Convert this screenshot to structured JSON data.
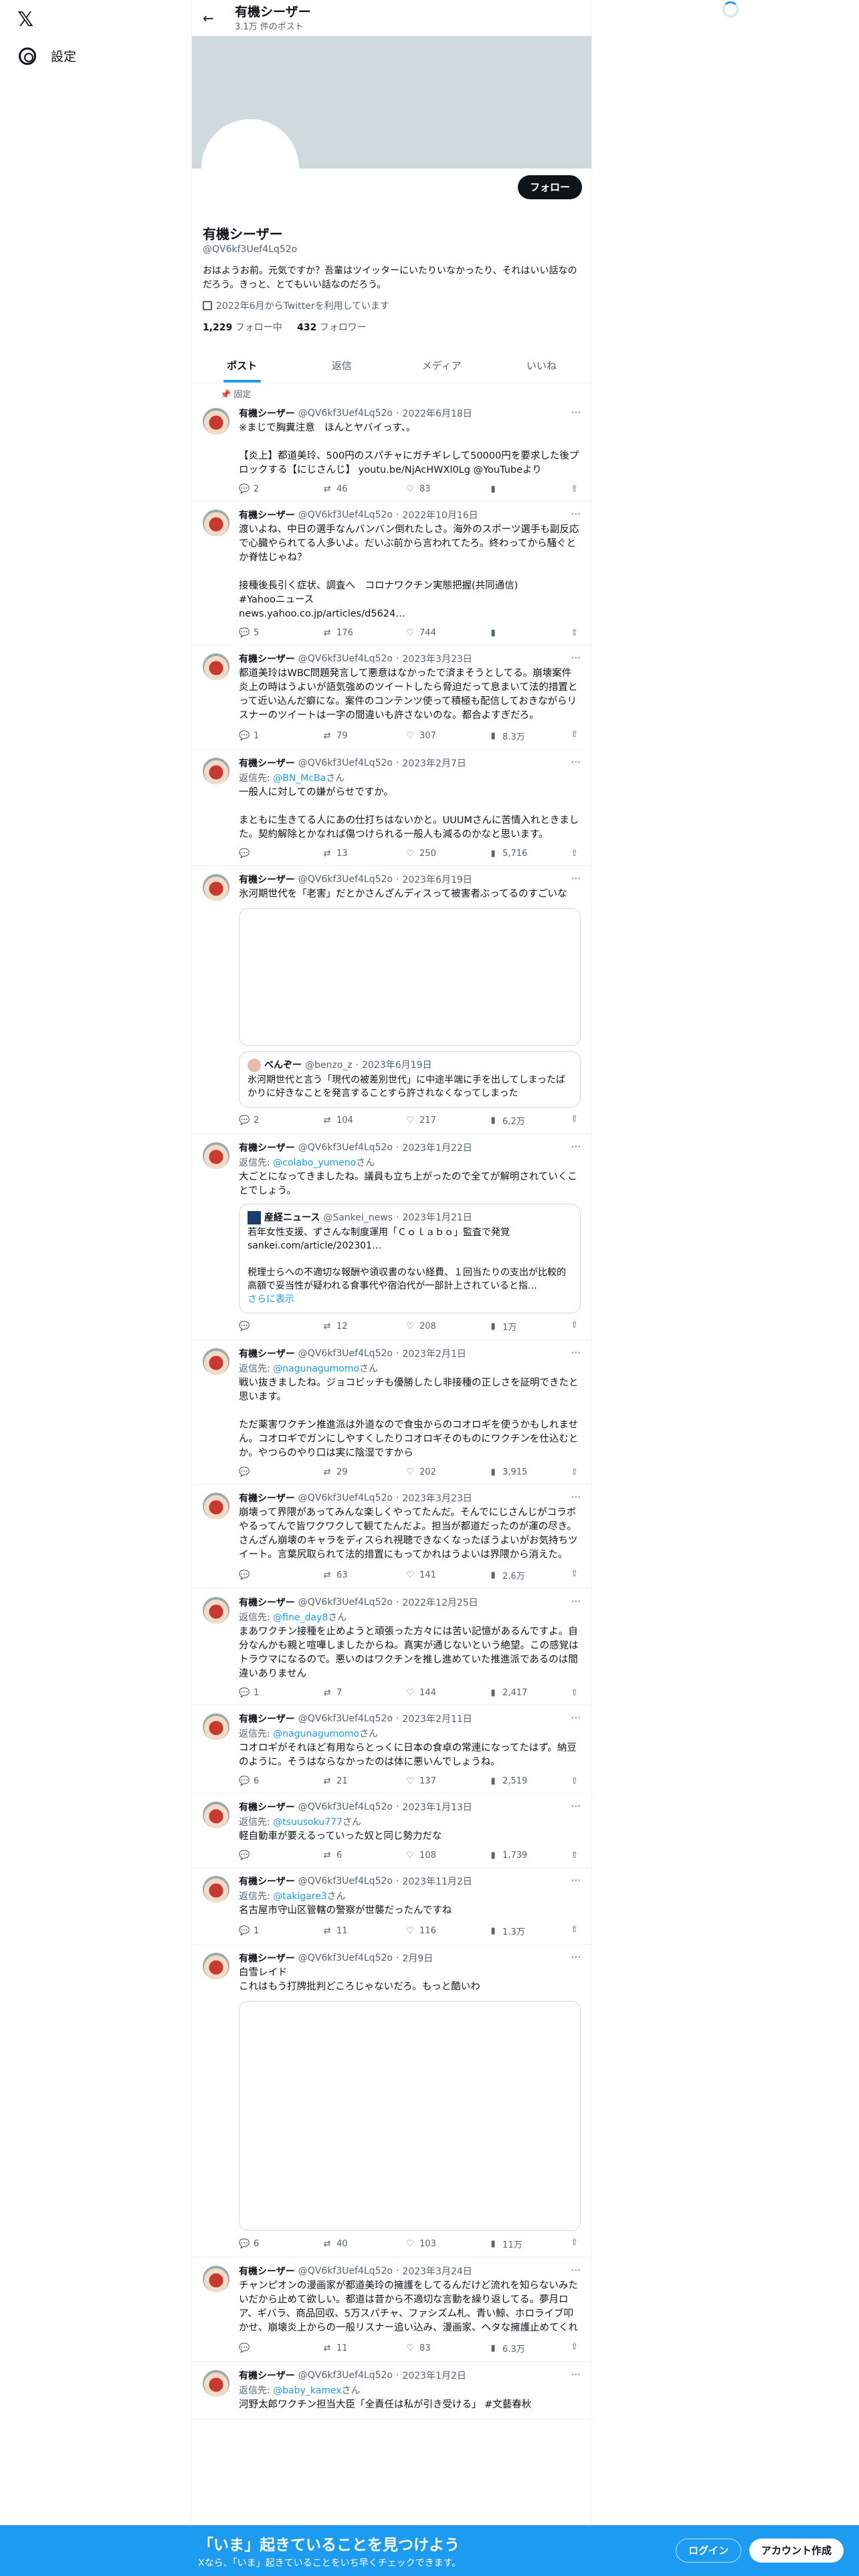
{
  "left": {
    "logo": "𝕏",
    "settings_label": "設定"
  },
  "header": {
    "name": "有機シーザー",
    "post_count": "3.1万 件のポスト"
  },
  "profile": {
    "follow_label": "フォロー",
    "name": "有機シーザー",
    "handle": "@QV6kf3Uef4Lq52o",
    "bio": "おはようお前。元気ですか？吾輩はツイッターにいたりいなかったり、それはいい話なのだろう。きっと、とてもいい話なのだろう。",
    "joined": "2022年6月からTwitterを利用しています",
    "following_count": "1,229",
    "following_label": "フォロー中",
    "followers_count": "432",
    "followers_label": "フォロワー"
  },
  "tabs": [
    "ポスト",
    "返信",
    "メディア",
    "いいね"
  ],
  "pinned_label": "固定",
  "tweets": [
    {
      "name": "有機シーザー",
      "handle": "@QV6kf3Uef4Lq52o",
      "date": "2022年6月18日",
      "reply": "",
      "text": "※まじで胸糞注意　ほんとヤバイっす、。\n\n【炎上】都道美玲、500円のスパチャにガチギレして50000円を要求した後プロックする【にじさんじ】 youtu.be/NjAcHWXl0Lg @YouTubeより",
      "replies": "2",
      "retweets": "46",
      "likes": "83",
      "views": ""
    },
    {
      "name": "有機シーザー",
      "handle": "@QV6kf3Uef4Lq52o",
      "date": "2022年10月16日",
      "reply": "",
      "text": "渡いよね、中日の選手なんバンバン倒れたしさ。海外のスポーツ選手も副反応で心臓やられてる人多いよ。だいぶ前から言われてたろ。終わってから騒ぐとか脊怯じゃね？\n\n接種後長引く症状、調査へ　コロナワクチン実態把握(共同通信)\n#Yahooニュース\nnews.yahoo.co.jp/articles/d5624…",
      "replies": "5",
      "retweets": "176",
      "likes": "744",
      "views": ""
    },
    {
      "name": "有機シーザー",
      "handle": "@QV6kf3Uef4Lq52o",
      "date": "2023年3月23日",
      "reply": "",
      "text": "都道美玲はWBC問題発言して悪意はなかったで済まそうとしてる。崩壊案件炎上の時はうよいが語気強めのツイートしたら脅迫だって息まいて法的措置とって近い込んだ癖にな。案件のコンテンツ使って積極も配信しておきながらリスナーのツイートは一字の間違いも許さないのな。都合よすぎだろ。",
      "replies": "1",
      "retweets": "79",
      "likes": "307",
      "views": "8.3万"
    },
    {
      "name": "有機シーザー",
      "handle": "@QV6kf3Uef4Lq52o",
      "date": "2023年2月7日",
      "reply": "@BN_McBa",
      "text": "一般人に対しての嫌がらせですか。\n\nまともに生きてる人にあの仕打ちはないかと。UUUMさんに苦情入れときました。契約解除とかなれば傷つけられる一般人も減るのかなと思います。",
      "replies": "",
      "retweets": "13",
      "likes": "250",
      "views": "5,716"
    },
    {
      "name": "有機シーザー",
      "handle": "@QV6kf3Uef4Lq52o",
      "date": "2023年6月19日",
      "reply": "",
      "text": "氷河期世代を「老害」だとかさんざんディスって被害者ぶってるのすごいな",
      "replies": "2",
      "retweets": "104",
      "likes": "217",
      "views": "6.2万",
      "quote": {
        "name": "べんぞー",
        "handle": "@benzo_z",
        "date": "2023年6月19日",
        "text": "氷河期世代と言う「現代の被差別世代」に中途半端に手を出してしまったばかりに好きなことを発言することすら許されなくなってしまった"
      }
    },
    {
      "name": "有機シーザー",
      "handle": "@QV6kf3Uef4Lq52o",
      "date": "2023年1月22日",
      "reply": "@colabo_yumeno",
      "text": "大ごとになってきましたね。議員も立ち上がったので全てが解明されていくことでしょう。",
      "replies": "",
      "retweets": "12",
      "likes": "208",
      "views": "1万",
      "quote": {
        "name": "産経ニュース",
        "handle": "@Sankei_news",
        "date": "2023年1月21日",
        "text": "若年女性支援、ずさんな制度運用「Ｃｏｌａｂｏ」監査で発覚\nsankei.com/article/202301…\n\n税理士らへの不適切な報酬や領収書のない経費、１回当たりの支出が比較的高額で妥当性が疑われる食事代や宿泊代が一部計上されていると指…",
        "more": "さらに表示"
      }
    },
    {
      "name": "有機シーザー",
      "handle": "@QV6kf3Uef4Lq52o",
      "date": "2023年2月1日",
      "reply": "@nagunagumomo",
      "text": "戦い抜きましたね。ジョコビッチも優勝したし非接種の正しさを証明できたと思います。\n\nただ薬害ワクチン推進派は外道なので食虫からのコオロギを使うかもしれません。コオロギでガンにしやすくしたりコオロギそのものにワクチンを仕込むとか。やつらのやり口は実に陰湿ですから",
      "replies": "",
      "retweets": "29",
      "likes": "202",
      "views": "3,915"
    },
    {
      "name": "有機シーザー",
      "handle": "@QV6kf3Uef4Lq52o",
      "date": "2023年3月23日",
      "reply": "",
      "text": "崩壊って界隈があってみんな楽しくやってたんだ。そんでにじさんじがコラボやるってんで皆ワクワクして観てたんだよ。担当が都道だったのが運の尽き。さんざん崩壊のキャラをディスられ視聴できなくなったぼうよいがお気持ちツイート。言葉尻取られて法的措置にもってかれはうよいは界隈から消えた。",
      "replies": "",
      "retweets": "63",
      "likes": "141",
      "views": "2.6万"
    },
    {
      "name": "有機シーザー",
      "handle": "@QV6kf3Uef4Lq52o",
      "date": "2022年12月25日",
      "reply": "@fine_day8",
      "text": "まあワクチン接種を止めようと頑張った方々には苦い記憶があるんですよ。自分なんかも親と喧嘩しましたからね。真実が通じないという絶望。この感覚はトラウマになるので。悪いのはワクチンを推し進めていた推進派であるのは間違いありません",
      "replies": "1",
      "retweets": "7",
      "likes": "144",
      "views": "2,417"
    },
    {
      "name": "有機シーザー",
      "handle": "@QV6kf3Uef4Lq52o",
      "date": "2023年2月11日",
      "reply": "@nagunagumomo",
      "text": "コオロギがそれほど有用ならとっくに日本の食卓の常連になってたはず。納豆のように。そうはならなかったのは体に悪いんでしょうね。",
      "replies": "6",
      "retweets": "21",
      "likes": "137",
      "views": "2,519"
    },
    {
      "name": "有機シーザー",
      "handle": "@QV6kf3Uef4Lq52o",
      "date": "2023年1月13日",
      "reply": "@tsuusoku777",
      "text": "軽自動車が要えるっていった奴と同じ勢力だな",
      "replies": "",
      "retweets": "6",
      "likes": "108",
      "views": "1,739"
    },
    {
      "name": "有機シーザー",
      "handle": "@QV6kf3Uef4Lq52o",
      "date": "2023年11月2日",
      "reply": "@takigare3",
      "text": "名古屋市守山区管轄の警察が世襲だったんですね",
      "replies": "1",
      "retweets": "11",
      "likes": "116",
      "views": "1.3万"
    },
    {
      "name": "有機シーザー",
      "handle": "@QV6kf3Uef4Lq52o",
      "date": "2月9日",
      "reply": "",
      "text": "白雪レイド\nこれはもう打牌批判どころじゃないだろ。もっと酷いわ",
      "replies": "6",
      "retweets": "40",
      "likes": "103",
      "views": "11万"
    },
    {
      "name": "有機シーザー",
      "handle": "@QV6kf3Uef4Lq52o",
      "date": "2023年3月24日",
      "reply": "",
      "text": "チャンピオンの漫画家が都道美玲の擁護をしてるんだけど流れを知らないみたいだから止めて欲しい。都道は昔から不適切な言動を繰り返してる。夢月ロア、ギバラ、商品回収、5万スパチャ、ファシズム札、青い鯨、ホロライブ叩かせ、崩壊炎上からの一般リスナー追い込み、漫画家、ヘタな擁護止めてくれ",
      "replies": "",
      "retweets": "11",
      "likes": "83",
      "views": "6.3万"
    },
    {
      "name": "有機シーザー",
      "handle": "@QV6kf3Uef4Lq52o",
      "date": "2023年1月2日",
      "reply": "@baby_kamex",
      "text": "河野太郎ワクチン担当大臣「全責任は私が引き受ける」 #文藝春秋",
      "replies": "",
      "retweets": "",
      "likes": "",
      "views": ""
    }
  ],
  "reply_prefix": "返信先: ",
  "reply_suffix": "さん",
  "bottom": {
    "title": "「いま」起きていることを見つけよう",
    "subtitle": "Xなら、「いま」起きていることをいち早くチェックできます。",
    "login": "ログイン",
    "signup": "アカウント作成"
  }
}
